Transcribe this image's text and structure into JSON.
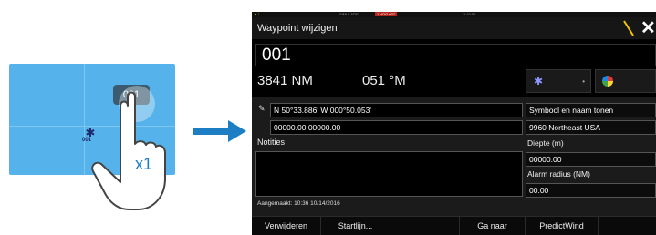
{
  "illustration": {
    "waypoint_bubble": "001",
    "waypoint_map_label": "001",
    "tap_count": "x1",
    "colors": {
      "map": "#56b2ea",
      "accent": "#1e7ec4"
    }
  },
  "panel": {
    "statusbar": {
      "simulator": "SIMULATIE",
      "center": "1 VOG 007",
      "time": "1:10:52"
    },
    "title": "Waypoint wijzigen",
    "name": "001",
    "distance": "3841 NM",
    "bearing": "051 °M",
    "symbol_icon": "waypoint-symbol-icon",
    "color_icon": "color-wheel-icon",
    "position": "N 50°33.886'  W 000°50.053'",
    "coordinates": "00000.00  00000.00",
    "notes_label": "Notities",
    "notes_value": "",
    "created": "Aangemaakt: 10:36  10/14/2016",
    "right": {
      "show_symbol_name": "Symbool en naam tonen",
      "region": "9960 Northeast USA",
      "depth_label": "Diepte (m)",
      "depth_value": "00000.00",
      "alarm_label": "Alarm radius (NM)",
      "alarm_value": "00.00"
    },
    "toolbar": {
      "delete": "Verwijderen",
      "start_line": "Startlijn...",
      "goto": "Ga naar",
      "predictwind": "PredictWind"
    },
    "colors": {
      "accent_slash": "#f5c400",
      "status_red": "#b3261e"
    }
  }
}
